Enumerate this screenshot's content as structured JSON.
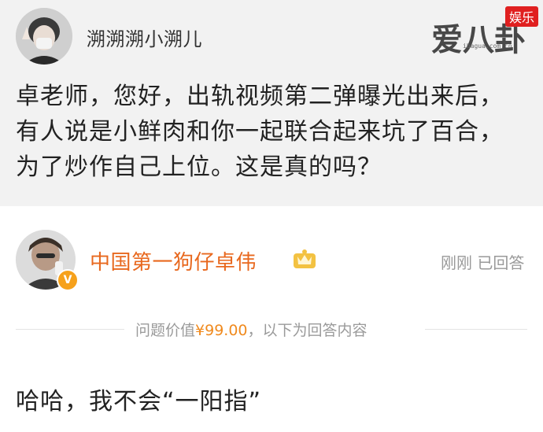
{
  "watermark": {
    "brand": "爱八卦",
    "badge": "娱乐",
    "url": "ibagua.com.cn"
  },
  "question": {
    "asker_name": "溯溯溯小溯儿",
    "text": "卓老师，您好，出轨视频第二弹曝光出来后，有人说是小鲜肉和你一起联合起来坑了百合，为了炒作自己上位。这是真的吗？"
  },
  "answer": {
    "answerer_name": "中国第一狗仔卓伟",
    "status_text": "刚刚 已回答",
    "price_prefix": "问题价值",
    "price_value": "¥99.00",
    "price_suffix": "，以下为回答内容",
    "text": "哈哈，我不会“一阳指”"
  },
  "colors": {
    "question_bg": "#f2f2f2",
    "answerer_name": "#e8681e",
    "price": "#f08a1e",
    "verified_badge": "#f6a11b",
    "watermark_badge": "#e02020"
  },
  "icons": [
    "user-avatar",
    "verified-v-icon",
    "vip-crown-icon"
  ]
}
